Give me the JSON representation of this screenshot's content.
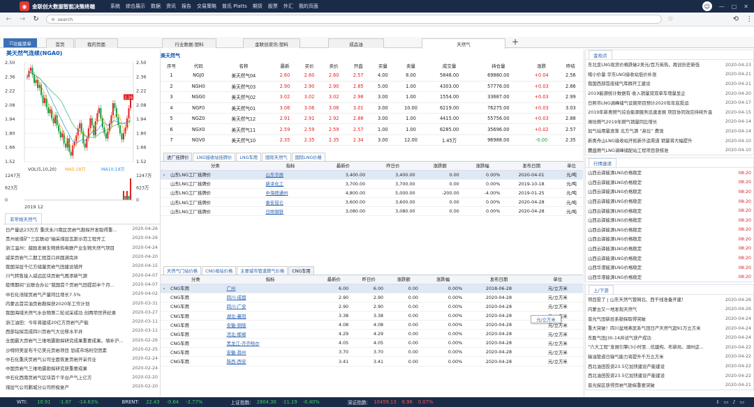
{
  "app": {
    "brand": "金联创大数据智能决策终端",
    "menu": [
      "系统",
      "综合展示",
      "数据",
      "资讯",
      "报告",
      "交易策略",
      "普氏 Platts",
      "期货",
      "股票",
      "外汇",
      "我的页面"
    ],
    "logo": "lc-logo-icon"
  },
  "browser": {
    "url_placeholder": "search"
  },
  "tabs": {
    "fn_button": "功能菜单",
    "items": [
      "首页",
      "我的页面",
      "行业数据:塑料",
      "金联创资讯:塑料",
      "成品油",
      "天然气"
    ]
  },
  "chart": {
    "title": "美天然气连续(NGA0)",
    "y_left": [
      "2.50",
      "2.36",
      "2.22",
      "2.08",
      "1.94",
      "1.80",
      "1.66",
      "1.52"
    ],
    "y_right": [
      "2.50",
      "2.36",
      "2.22",
      "2.08",
      "1.94",
      "1.80",
      "1.66",
      "1.52"
    ],
    "vol_label": "VOL(5,10,20)",
    "ma5": "MA5:18万",
    "ma10": "MA10:19万",
    "vol_left": [
      "1247万",
      "623万",
      "0"
    ],
    "vol_right": [
      "1247万",
      "623万",
      "0"
    ],
    "x_label": "2019 12",
    "price_tag": "2.16"
  },
  "chart_data": {
    "type": "line",
    "title": "美天然气连续(NGA0)",
    "ylim": [
      1.52,
      2.5
    ],
    "series": [
      {
        "name": "NGA0",
        "values": [
          2.36,
          2.42,
          2.45,
          2.38,
          2.3,
          2.33,
          2.25,
          2.28,
          2.18,
          2.1,
          2.15,
          2.06,
          2.0,
          2.04,
          1.95,
          1.9,
          1.98,
          1.88,
          1.82,
          1.76,
          1.8,
          1.7,
          1.66,
          1.75,
          1.62,
          1.58,
          1.68,
          1.72,
          1.78,
          1.85,
          1.9,
          1.82,
          1.7,
          1.66,
          1.75,
          1.85,
          1.95,
          1.88,
          1.78,
          1.92,
          2.0,
          2.05,
          1.95,
          1.86,
          1.8,
          1.75,
          1.82,
          1.9,
          1.98,
          2.1,
          2.05,
          1.96,
          1.88,
          1.8,
          1.74,
          1.8,
          1.86,
          1.95,
          2.05,
          2.16
        ]
      }
    ]
  },
  "left_news": {
    "tab": "非常规天然气",
    "items": [
      [
        "日产量达23万方 重庆永川南区页岩气勘探开发取得重...",
        "2020-04-26"
      ],
      [
        "贵州省煤矿“三区联动”抽采煤层瓦斯示范工程开工",
        "2020-04-26"
      ],
      [
        "浙江温州：鼓励发展生物质热电联产业生物天然气项目",
        "2020-04-24"
      ],
      [
        "威荣页岩气二期工程首口井圆满完井",
        "2020-04-20"
      ],
      [
        "我国深层千亿方储量页岩气田建设铺开",
        "2020-04-15"
      ],
      [
        "川气转售接入威远区块页岩气再添新气源",
        "2020-04-07"
      ],
      [
        "疫情期间“云联合办公”我国首个页岩气田提前半个月...",
        "2020-04-07"
      ],
      [
        "中石化涪陵页岩气产量同比增长7.5%",
        "2020-04-02"
      ],
      [
        "内蒙古首宗油页岩勘探获2020年工作计划",
        "2020-03-31"
      ],
      [
        "我国海域天然气水合物第二轮试采成功 创两项世界纪录",
        "2020-03-27"
      ],
      [
        "浙江油田：今年将建成20亿方页岩气产能",
        "2020-03-11"
      ],
      [
        "西部钻探完成四川页岩气大位移水平井",
        "2020-03-11"
      ],
      [
        "全国最大页岩气三维地震勘探研究成果重要成果。填补沪...",
        "2020-02-26"
      ],
      [
        "沙特阿美宣布千亿美元页岩项目 恐成市场利空因素",
        "2020-02-25"
      ],
      [
        "中石化重庆页岩气公司全面恢复页岩开采作业",
        "2020-02-24"
      ],
      [
        "中国页岩气三维地震勘探研究获重要成果",
        "2020-02-24"
      ],
      [
        "中石化西南页岩气区块首个平台产气上亿方",
        "2020-02-20"
      ],
      [
        "煤层气公司鹏城分公司积极复产",
        "2020-02-20"
      ]
    ]
  },
  "quote": {
    "section": "美天然气",
    "headers": [
      "序号",
      "代码",
      "名称",
      "最新",
      "买价",
      "卖价",
      "开盘",
      "买量",
      "卖量",
      "成交量",
      "持仓量",
      "涨跌",
      "昨结"
    ],
    "rows": [
      [
        "1",
        "NGJ0",
        "美天然气04",
        "2.60",
        "2.60",
        "2.60",
        "2.57",
        "4.00",
        "8.00",
        "5848.00",
        "69880.00",
        "+0.04",
        "2.56"
      ],
      [
        "2",
        "NGH0",
        "美天然气03",
        "2.90",
        "2.90",
        "2.90",
        "2.85",
        "5.00",
        "1.00",
        "4303.00",
        "57776.00",
        "+0.03",
        "2.86"
      ],
      [
        "3",
        "NGG0",
        "美天然气02",
        "3.02",
        "3.02",
        "3.02",
        "2.98",
        "3.00",
        "1.00",
        "1554.00",
        "33687.00",
        "+0.03",
        "2.99"
      ],
      [
        "4",
        "NGF0",
        "美天然气01",
        "3.06",
        "3.06",
        "3.06",
        "3.01",
        "3.00",
        "10.00",
        "6219.00",
        "76275.00",
        "+0.03",
        "3.03"
      ],
      [
        "5",
        "NGZ0",
        "美天然气12",
        "2.91",
        "2.91",
        "2.92",
        "2.88",
        "3.00",
        "1.00",
        "4415.00",
        "55756.00",
        "+0.03",
        "2.88"
      ],
      [
        "6",
        "NGX0",
        "美天然气11",
        "2.59",
        "2.59",
        "2.59",
        "2.57",
        "1.00",
        "1.00",
        "6285.00",
        "35696.00",
        "+0.02",
        "2.57"
      ],
      [
        "7",
        "NGV0",
        "美天然气10",
        "2.35",
        "2.35",
        "2.35",
        "2.34",
        "3.00",
        "12.00",
        "1.45万",
        "96988.00",
        "-0.00",
        "2.35"
      ]
    ]
  },
  "lng": {
    "tabs": [
      "进厂挂牌价",
      "LNG接收站挂牌价",
      "LNG车用",
      "国际天然气",
      "国际LNG价格"
    ],
    "headers": [
      "分类",
      "指标",
      "最新价",
      "昨日价",
      "涨跌额",
      "涨跌幅",
      "发布日期",
      "单位"
    ],
    "rows": [
      [
        "山东LNG工厂挂牌价",
        "山东华辰",
        "3,400.00",
        "3,400.00",
        "0.00",
        "0.00%",
        "2020-04-01",
        "元/吨"
      ],
      [
        "山东LNG工厂挂牌价",
        "新泽化工",
        "3,700.00",
        "3,700.00",
        "0.00",
        "0.00%",
        "2019-10-18",
        "元/吨"
      ],
      [
        "山东LNG工厂挂牌价",
        "中海德通州",
        "4,800.00",
        "5,000.00",
        "-200.00",
        "-4.00%",
        "2019-01-25",
        "元/吨"
      ],
      [
        "山东LNG工厂挂牌价",
        "泰安昆仑",
        "3,600.00",
        "3,600.00",
        "0.00",
        "0.00%",
        "2020-04-28",
        "元/吨"
      ],
      [
        "山东LNG工厂挂牌价",
        "日照钢铁",
        "3,080.00",
        "3,080.00",
        "0.00",
        "0.00%",
        "2020-04-28",
        "元/吨"
      ]
    ]
  },
  "cng": {
    "tabs": [
      "天然气门站价格",
      "CNG母站价格",
      "主要城市管道燃气价格",
      "CNG车用"
    ],
    "headers": [
      "分类",
      "指标",
      "最新价",
      "昨日价",
      "涨跌额",
      "涨跌幅",
      "发布日期",
      "单位"
    ],
    "rows": [
      [
        "CNG车用",
        "广州",
        "6.00",
        "6.00",
        "0.00",
        "0.00%",
        "2018-06-28",
        "元/立方米"
      ],
      [
        "CNG车用",
        "四川-成都",
        "2.90",
        "2.90",
        "0.00",
        "0.00%",
        "2020-04-28",
        "元/立方米"
      ],
      [
        "CNG车用",
        "四川-广安",
        "2.90",
        "2.90",
        "0.00",
        "0.00%",
        "2020-04-28",
        "元/立方米"
      ],
      [
        "CNG车用",
        "湖北-襄阳",
        "3.38",
        "3.38",
        "0.00",
        "0.00%",
        "2020-04-28",
        "元/立方米"
      ],
      [
        "CNG车用",
        "安徽-铜陵",
        "4.08",
        "4.08",
        "0.00",
        "0.00%",
        "2020-04-28",
        "元/立方米"
      ],
      [
        "CNG车用",
        "河北-邯郸",
        "4.29",
        "4.29",
        "0.00",
        "0.00%",
        "2020-04-28",
        "元/立方米"
      ],
      [
        "CNG车用",
        "黑龙江-齐齐哈尔",
        "4.05",
        "4.05",
        "0.00",
        "0.00%",
        "2020-04-28",
        "元/立方米"
      ],
      [
        "CNG车用",
        "安徽-滁州",
        "3.70",
        "3.70",
        "0.00",
        "0.00%",
        "2020-04-28",
        "元/立方米"
      ],
      [
        "CNG车用",
        "陕西-西安",
        "3.41",
        "3.41",
        "0.00",
        "0.00%",
        "2020-04-28",
        "元/立方米"
      ]
    ],
    "tooltip": "元/立方米"
  },
  "right1": {
    "tab": "金视点",
    "items": [
      [
        "东北亚LNG现货价格跌破2美元/百万英热，再创历史新低",
        "2020-04-23"
      ],
      [
        "喀小价量 华东LNG接收站低价补涨",
        "2020-04-21"
      ],
      [
        "我国西部首座储气库群开工建设",
        "2020-04-21"
      ],
      [
        "2019能源统计数据有 收入销量双双单车增量显企",
        "2020-04-20"
      ],
      [
        "日照市LNG调峰储气设施项目预计2020年年底投运",
        "2020-04-17"
      ],
      [
        "2019年新奥燃气综合能源服务迅速发展 项目协同效应持续升温",
        "2020-04-15"
      ],
      [
        "潍坊燃气2019年燃气销量同比增长",
        "2020-04-14"
      ],
      [
        "加气站用量逐渐 北方气源 “高位” 费涨",
        "2020-04-14"
      ],
      [
        "新奥舟山LNG接收站开拓新外运渠道 销量将大幅提升",
        "2020-04-10"
      ],
      [
        "麓盛燃气LNG调峰储配站工程项目获核准",
        "2020-04-10"
      ]
    ]
  },
  "right2": {
    "tab": "行情速递",
    "items": [
      [
        "山西云驿能源LNG价格稳定",
        "08:20"
      ],
      [
        "山西云驿能源LNG价格稳定",
        "08:20"
      ],
      [
        "山西云驿能源LNG价格稳定",
        "08:20"
      ],
      [
        "山西云驿能源LNG价格稳定",
        "08:20"
      ],
      [
        "山西云驿能源LNG价格稳定",
        "08:20"
      ],
      [
        "山西云驿能源LNG价格稳定",
        "08:20"
      ],
      [
        "山西云驿能源LNG价格稳定",
        "08:20"
      ],
      [
        "山西云驿能源LNG价格稳定",
        "08:20"
      ],
      [
        "山西云驿能源LNG价格稳定",
        "08:20"
      ],
      [
        "山西云驿能源LNG价格稳定",
        "08:20"
      ],
      [
        "山西华港能源LNG价格稳定",
        "08:20"
      ],
      [
        "山西华港能源LNG价格稳定",
        "08:20"
      ]
    ]
  },
  "right3": {
    "tab": "上/下游",
    "items": [
      [
        "项目投了 | 山东天然气管网北、西干线准备开建！",
        "2020-04-26"
      ],
      [
        "内蒙古又一地发现天然气",
        "2020-04-26"
      ],
      [
        "普光气田新层系勘探取得突破",
        "2020-04-24"
      ],
      [
        "重大突破！四川盆地寒武系气田日产天然气超91万立方米",
        "2020-04-24"
      ],
      [
        "东胜气田J30-14井试气获产成功",
        "2020-04-24"
      ],
      [
        "“六大工程”发展引擎(3小时至...优建构、布新局，湖州这...",
        "2020-04-22"
      ],
      [
        "输油管道日输气能力将提升千万立方米",
        "2020-04-22"
      ],
      [
        "西北油田投资23.5亿加快建设产能建设",
        "2020-04-22"
      ],
      [
        "西北油田投资23.5亿加快建设产能建设",
        "2020-04-22"
      ],
      [
        "普光探区获得页岩气勘探重要突破",
        "2020-04-21"
      ]
    ]
  },
  "status": {
    "wti": "WTI:",
    "wti_v": "10.91",
    "wti_c": "-1.87",
    "wti_p": "-14.63%",
    "brent": "BRENT:",
    "brent_v": "22.43",
    "brent_c": "-0.64",
    "brent_p": "-2.77%",
    "sh": "上证指数:",
    "sh_v": "2804.30",
    "sh_c": "-11.19",
    "sh_p": "-0.40%",
    "sz": "深证指数:",
    "sz_v": "10459.13",
    "sz_c": "6.96",
    "sz_p": "0.07%"
  },
  "colors": {
    "up": "#e02020",
    "down": "#169a3a",
    "accent": "#2862b0",
    "topbar": "#1a2b47"
  }
}
